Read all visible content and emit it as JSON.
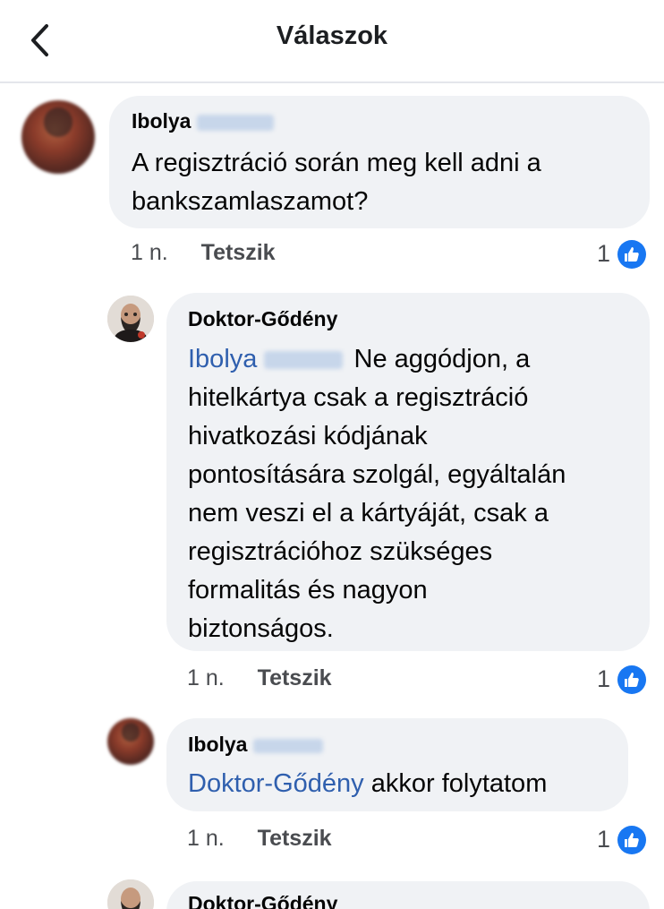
{
  "header": {
    "title": "Válaszok",
    "back_icon": "chevron-left-icon"
  },
  "comments": [
    {
      "author": "Ibolya",
      "text_lines": [
        "A regisztráció során meg kell adni a",
        "bankszamlaszamot?"
      ],
      "time": "1 n.",
      "like_label": "Tetszik",
      "like_count": "1"
    },
    {
      "author": "Doktor-Gődény",
      "mention": "Ibolya",
      "first_line_rest": "Ne aggódjon, a",
      "text_lines": [
        "hitelkártya csak a regisztráció",
        "hivatkozási kódjának",
        "pontosítására szolgál, egyáltalán",
        "nem veszi el a kártyáját, csak a",
        "regisztrációhoz szükséges",
        "formalitás és nagyon",
        "biztonságos."
      ],
      "time": "1 n.",
      "like_label": "Tetszik",
      "like_count": "1"
    },
    {
      "author": "Ibolya",
      "mention": "Doktor-Gődény",
      "text": "akkor folytatom",
      "time": "1 n.",
      "like_label": "Tetszik",
      "like_count": "1"
    },
    {
      "author": "Doktor-Gődény"
    }
  ],
  "colors": {
    "mention": "#2f5fae",
    "like_blue": "#1877f2",
    "bubble": "#f0f2f5"
  }
}
